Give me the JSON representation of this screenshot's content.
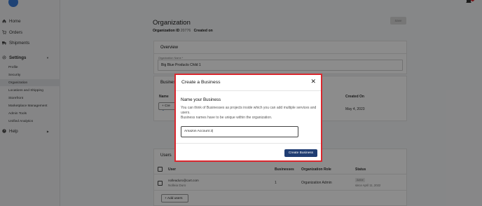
{
  "sidebar": {
    "items": [
      {
        "label": "Home",
        "icon": "home-icon"
      },
      {
        "label": "Orders",
        "icon": "cart-icon"
      },
      {
        "label": "Shipments",
        "icon": "truck-icon"
      },
      {
        "label": "Settings",
        "icon": "gear-icon"
      }
    ],
    "settings_sub": [
      "Profile",
      "Security",
      "Organization",
      "Locations and Shipping",
      "Storefront",
      "Marketplace Management",
      "Admin Tools",
      "Unified Analytics"
    ],
    "help": {
      "label": "Help",
      "icon": "help-icon"
    }
  },
  "header": {
    "title": "Organization",
    "org_id_label": "Organization ID",
    "org_id_value": "20776",
    "created_label": "Created on",
    "save_label": "Save"
  },
  "overview": {
    "title": "Overview",
    "name_label": "Organization Name *",
    "name_value": "Big Blue Products Child 1"
  },
  "businesses": {
    "title": "Businesses",
    "col_name": "Name",
    "col_created": "Created On",
    "row_name": "Big Blue",
    "row_created": "May 4, 2023",
    "create_label": "+ Cre"
  },
  "users": {
    "title": "Users",
    "col_user": "User",
    "col_businesses": "Businesses",
    "col_role": "Organization Role",
    "col_status": "Status",
    "row_email": "nolleaduro@cart.com",
    "row_name": "Nolleia Duro",
    "row_businesses": "1",
    "row_role": "Organization Admin",
    "row_status_badge": "Active",
    "row_status_since": "since April 11, 2022",
    "add_label": "+ Add users"
  },
  "modal": {
    "title": "Create a Business",
    "heading": "Name your Business",
    "desc1": "You can think of Businesses as projects inside which you can add multiple services and users.",
    "desc2": "Business names have to be unique within the organization.",
    "input_value": "Amazon Account 2|",
    "submit_label": "Create Business",
    "close_icon": "close-icon"
  },
  "colors": {
    "accent": "#1f3d73",
    "modal_border": "#d9272e",
    "link": "#2563a8"
  }
}
